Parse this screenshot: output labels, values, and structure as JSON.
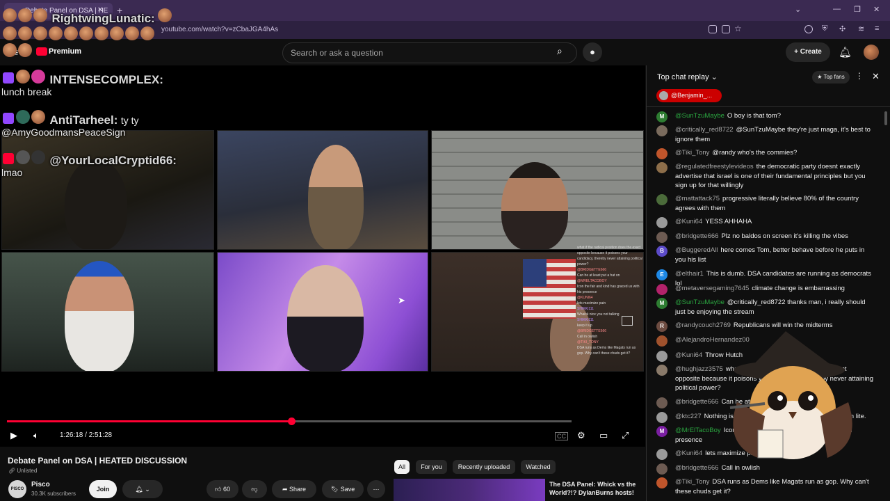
{
  "browser": {
    "tab_title": "Debate Panel on DSA | HE",
    "url": "youtube.com/watch?v=zCbaJGA4hAs"
  },
  "yt_header": {
    "premium_label": "Premium",
    "search_placeholder": "Search or ask a question",
    "create_label": "Create"
  },
  "stream_overlay": {
    "messages": [
      {
        "name": "RightwingLunatic:",
        "text": ""
      },
      {
        "name": "INTENSECOMPLEX:",
        "text": "lunch break"
      },
      {
        "name": "AntiTarheel:",
        "text": "ty ty"
      },
      {
        "name": "",
        "text": "@AmyGoodmansPeaceSign"
      },
      {
        "name": "@YourLocalCryptid66:",
        "text": "lmao"
      }
    ]
  },
  "mini_chat": [
    "what if the radical position does the exact opposite because it poisons your candidacy, thereby never attaining political power?",
    "@BRIDGETTE666",
    "Can he at least put a hat on",
    "@MRELTACOBOY",
    "Icon the fair and kind has graced us with his presence",
    "@KUNI64",
    "lets maximize pain",
    "SHIKKI111",
    "Whaick nice you not talking",
    "SHIKKI111",
    "keep it up",
    "@BRIDGETTE666",
    "Call in owlish",
    "@TIKI_TONY",
    "DSA runs as Dems like Magats run as gop. Why can't these chuds get it?"
  ],
  "player": {
    "time_current": "1:26:18",
    "time_separator": "/",
    "time_total": "2:51:28",
    "progress_fraction": 0.5034
  },
  "video": {
    "title": "Debate Panel on DSA | HEATED DISCUSSION",
    "visibility": "Unlisted",
    "channel_name": "Pisco",
    "channel_avatar_text": "PISCO",
    "subscribers": "30.3K subscribers",
    "join_label": "Join",
    "likes": "60",
    "share_label": "Share",
    "save_label": "Save"
  },
  "recommendations": {
    "chips": [
      "All",
      "For you",
      "Recently uploaded",
      "Watched"
    ],
    "first_title": "The DSA Panel: Whick vs the World?!? DylanBurns hosts!"
  },
  "chat": {
    "header_title": "Top chat replay",
    "top_fans_label": "Top fans",
    "pinned_user": "@Benjamin_...",
    "messages": [
      {
        "avatar": "M",
        "avatar_color": "#2e7d32",
        "name": "@SunTzuMaybe",
        "member": true,
        "text": "O boy is that tom?"
      },
      {
        "avatar": "",
        "avatar_color": "#7a6b5d",
        "name": "@critically_red8722",
        "member": false,
        "text": "@SunTzuMaybe they're just maga, it's best to ignore them"
      },
      {
        "avatar": "",
        "avatar_color": "#c0552b",
        "name": "@Tiki_Tony",
        "member": false,
        "text": "@randy who's the commies?"
      },
      {
        "avatar": "",
        "avatar_color": "#8d6e4a",
        "name": "@regulatedfreestylevideos",
        "member": false,
        "text": "the democratic party doesnt exactly advertise that israel is one of their fundamental principles but you sign up for that willingly"
      },
      {
        "avatar": "",
        "avatar_color": "#4b6b3a",
        "name": "@mattattack75",
        "member": false,
        "text": "progressive literally believe 80% of the country agrees with them"
      },
      {
        "avatar": "",
        "avatar_color": "#9a9a9a",
        "name": "@Kuni64",
        "member": false,
        "text": "YESS AHHAHA"
      },
      {
        "avatar": "",
        "avatar_color": "#6d5b52",
        "name": "@bridgette666",
        "member": false,
        "text": "Plz no baldos on screen it's killing the vibes"
      },
      {
        "avatar": "B",
        "avatar_color": "#5c4bc9",
        "name": "@BuggeredAll",
        "member": false,
        "text": "here comes Tom, better behave before he puts in you his list"
      },
      {
        "avatar": "E",
        "avatar_color": "#1e88e5",
        "name": "@elthair1",
        "member": false,
        "text": "This is dumb. DSA candidates are running as democrats lol"
      },
      {
        "avatar": "",
        "avatar_color": "#b2226a",
        "name": "@metaversegaming7645",
        "member": false,
        "text": "climate change is embarrassing"
      },
      {
        "avatar": "M",
        "avatar_color": "#2e7d32",
        "name": "@SunTzuMaybe",
        "member": true,
        "text": "@critically_red8722 thanks man, i really should just be enjoying the stream"
      },
      {
        "avatar": "R",
        "avatar_color": "#6d4c41",
        "name": "@randycouch2769",
        "member": false,
        "text": "Republicans will win the midterms"
      },
      {
        "avatar": "",
        "avatar_color": "#a0522d",
        "name": "@AlejandroHernandez00",
        "member": false,
        "text": ""
      },
      {
        "avatar": "",
        "avatar_color": "#9a9a9a",
        "name": "@Kuni64",
        "member": false,
        "text": "Throw Hutch"
      },
      {
        "avatar": "",
        "avatar_color": "#8a7a6a",
        "name": "@hughjazz3575",
        "member": false,
        "text": "what if the radical position does the exact opposite because it poisons your candidacy, thereby never attaining political power?"
      },
      {
        "avatar": "",
        "avatar_color": "#6d5b52",
        "name": "@bridgette666",
        "member": false,
        "text": "Can he at least put a hat on"
      },
      {
        "avatar": "",
        "avatar_color": "#9a9a9a",
        "name": "@ktc227",
        "member": false,
        "text": "Nothing is more fascist than a right-winger who can lite."
      },
      {
        "avatar": "M",
        "avatar_color": "#7b1fa2",
        "name": "@MrElTacoBoy",
        "member": true,
        "text": "Icon the fair and kind has graced us with his presence"
      },
      {
        "avatar": "",
        "avatar_color": "#9a9a9a",
        "name": "@Kuni64",
        "member": false,
        "text": "lets maximize pain"
      },
      {
        "avatar": "",
        "avatar_color": "#6d5b52",
        "name": "@bridgette666",
        "member": false,
        "text": "Call in owlish"
      },
      {
        "avatar": "",
        "avatar_color": "#c0552b",
        "name": "@Tiki_Tony",
        "member": false,
        "text": "DSA runs as Dems like Magats run as gop. Why can't these chuds get it?"
      }
    ]
  }
}
